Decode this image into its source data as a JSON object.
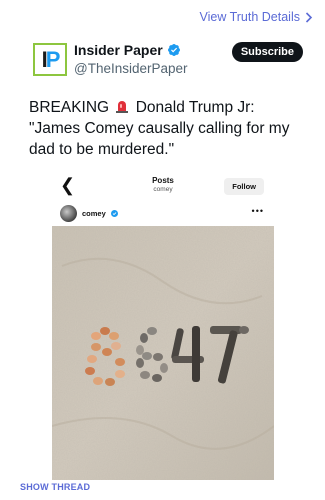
{
  "top_link": {
    "label": "View Truth Details",
    "icon": "chevron-right-icon"
  },
  "account": {
    "logo_text": "IP",
    "name": "Insider Paper",
    "handle": "@TheInsiderPaper",
    "verified_icon": "verified-badge-icon",
    "subscribe_label": "Subscribe"
  },
  "tweet": {
    "prefix": "BREAKING",
    "emoji_icon": "siren-icon",
    "text": "Donald Trump Jr: \"James Comey causally calling for my dad to be murdered.\""
  },
  "embedded_post": {
    "back_icon": "chevron-left-icon",
    "title": "Posts",
    "subtitle": "comey",
    "follow_label": "Follow",
    "username": "comey",
    "more_icon": "more-horizontal-icon",
    "photo_icon": "shells-in-sand-photo"
  },
  "show_thread_label": "SHOW THREAD",
  "colors": {
    "link": "#5b6bd6",
    "verified": "#1d9bf0",
    "logo_border": "#8dc63f",
    "sand": "#cfc6b8"
  }
}
